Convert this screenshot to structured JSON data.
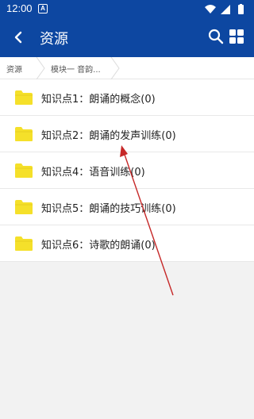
{
  "status_bar": {
    "time": "12:00",
    "app_icon_letter": "A"
  },
  "app_bar": {
    "title": "资源"
  },
  "breadcrumb": {
    "items": [
      "资源",
      "模块一 音韵..."
    ]
  },
  "folders": [
    {
      "label": "知识点1：朗诵的概念(0)"
    },
    {
      "label": "知识点2：朗诵的发声训练(0)"
    },
    {
      "label": "知识点4：语音训练(0)"
    },
    {
      "label": "知识点5：朗诵的技巧训练(0)"
    },
    {
      "label": "知识点6：诗歌的朗诵(0)"
    }
  ],
  "colors": {
    "primary": "#0d47a1",
    "folder": "#f5e02a",
    "arrow": "#c62828"
  }
}
